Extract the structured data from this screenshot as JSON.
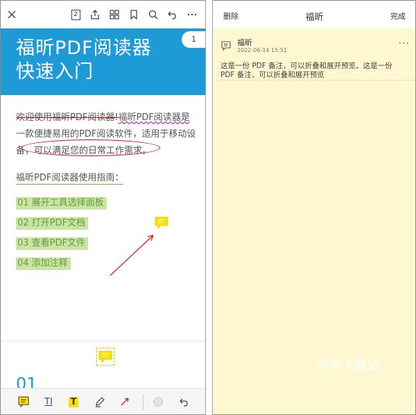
{
  "reader": {
    "toolbar": {
      "close_icon": "close-icon",
      "page_count": "2",
      "icons": [
        "share-icon",
        "grid-icon",
        "bookmark-icon",
        "search-icon",
        "undo-icon",
        "more-icon"
      ]
    },
    "banner": {
      "title_line1": "福昕PDF阅读器",
      "title_line2": "快速入门",
      "page_badge": "1",
      "color": "#1e9ad6"
    },
    "body": {
      "para_line1_strike": "欢迎使用福昕PDF阅读器!",
      "para_line1_wavy": "福昕PDF阅读器是",
      "para_line2": "一款便捷易用的PDF阅读软件，适用于移动设",
      "para_line3_a": "备，",
      "para_line3_circled": "可以满足您的日常工作需求。",
      "guide_title": "福昕PDF阅读器使用指南：",
      "steps": [
        "01  展开工具选择面板",
        "02  打开PDF文档",
        "03  查看PDF文件",
        "04  添加注释"
      ],
      "section_number": "01"
    },
    "bottom_toolbar": {
      "icons": [
        "note-icon",
        "text-insert-icon",
        "highlight-text-icon",
        "pencil-icon",
        "arrow-icon",
        "color-circle-icon",
        "undo-icon"
      ],
      "text_insert_label": "TI",
      "highlight_label": "T"
    }
  },
  "note_panel": {
    "header": {
      "delete_label": "删除",
      "title": "福昕",
      "done_label": "完成"
    },
    "note": {
      "author": "福昕",
      "timestamp": "2022-06-14 15:51",
      "more": "···",
      "text": "这是一份 PDF 备注，可以折叠和展开预览。这是一份 PDF 备注，可以折叠和展开预览"
    },
    "watermark": "乐哥下载站",
    "background": "#fff7cf"
  }
}
